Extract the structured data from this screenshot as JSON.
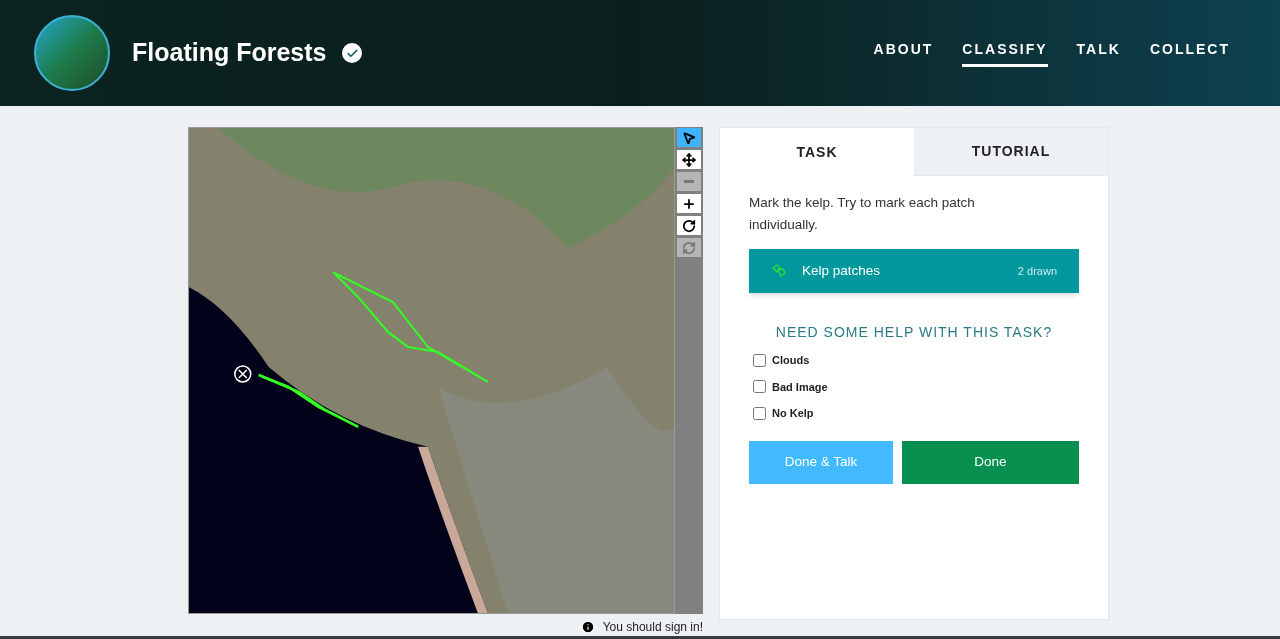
{
  "header": {
    "title": "Floating Forests",
    "verified": true,
    "nav": [
      {
        "label": "ABOUT",
        "selected": false
      },
      {
        "label": "CLASSIFY",
        "selected": true
      },
      {
        "label": "TALK",
        "selected": false
      },
      {
        "label": "COLLECT",
        "selected": false
      }
    ]
  },
  "viewer": {
    "tools": [
      {
        "kind": "pointer",
        "selected": true,
        "disabled": false
      },
      {
        "kind": "move",
        "selected": false,
        "disabled": false
      },
      {
        "kind": "zoom-out",
        "selected": false,
        "disabled": true
      },
      {
        "kind": "zoom-in",
        "selected": false,
        "disabled": false
      },
      {
        "kind": "rotate",
        "selected": false,
        "disabled": false
      },
      {
        "kind": "reset",
        "selected": false,
        "disabled": true
      }
    ],
    "notice": "You should sign in!"
  },
  "task_panel": {
    "tabs": [
      {
        "label": "TASK",
        "selected": true
      },
      {
        "label": "TUTORIAL",
        "selected": false
      }
    ],
    "instruction": "Mark the kelp. Try to mark each patch individually.",
    "tool": {
      "label": "Kelp patches",
      "count": "2 drawn",
      "selected": true
    },
    "help_title": "NEED SOME HELP WITH THIS TASK?",
    "options": [
      {
        "label": "Clouds",
        "checked": false
      },
      {
        "label": "Bad Image",
        "checked": false
      },
      {
        "label": "No Kelp",
        "checked": false
      }
    ],
    "buttons": [
      {
        "kind": "talk",
        "label": "Done & Talk"
      },
      {
        "kind": "done",
        "label": "Done"
      }
    ]
  }
}
